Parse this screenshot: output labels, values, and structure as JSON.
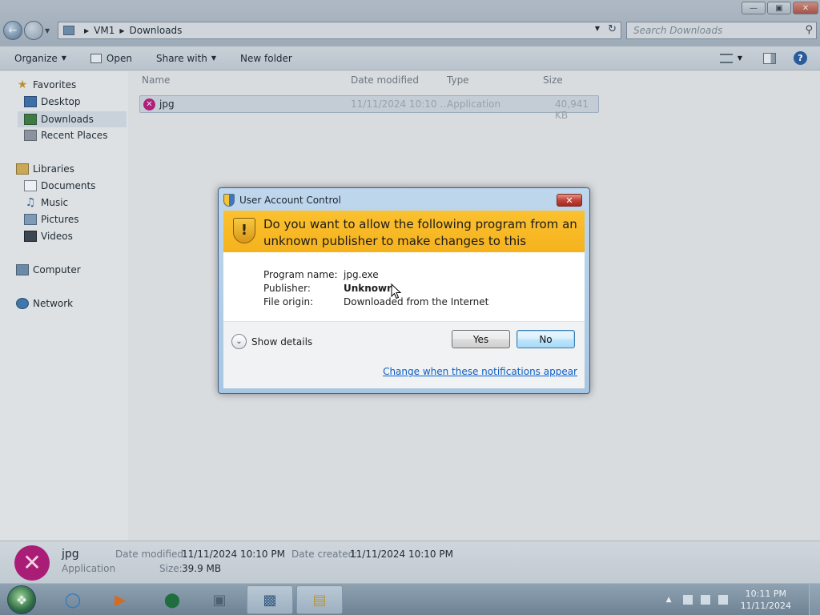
{
  "window": {
    "address": [
      "VM1",
      "Downloads"
    ],
    "search_placeholder": "Search Downloads",
    "buttons": {
      "minimize": "▭",
      "maximize": "▣",
      "close": "✕"
    }
  },
  "toolbar": {
    "organize": "Organize",
    "open": "Open",
    "share_with": "Share with",
    "new_folder": "New folder"
  },
  "sidebar": {
    "favorites": "Favorites",
    "desktop": "Desktop",
    "downloads": "Downloads",
    "recent_places": "Recent Places",
    "libraries": "Libraries",
    "documents": "Documents",
    "music": "Music",
    "pictures": "Pictures",
    "videos": "Videos",
    "computer": "Computer",
    "network": "Network"
  },
  "file_list": {
    "columns": [
      "Name",
      "Date modified",
      "Type",
      "Size"
    ],
    "rows": [
      {
        "name": "jpg",
        "date_modified": "11/11/2024 10:10 ...",
        "type": "Application",
        "size": "40,941 KB",
        "selected": true
      }
    ]
  },
  "details_pane": {
    "name": "jpg",
    "type": "Application",
    "date_modified_label": "Date modified:",
    "date_modified": "11/11/2024 10:10 PM",
    "date_created_label": "Date created:",
    "date_created": "11/11/2024 10:10 PM",
    "size_label": "Size:",
    "size": "39.9 MB"
  },
  "uac_dialog": {
    "title": "User Account Control",
    "question": "Do you want to allow the following program from an unknown publisher to make changes to this computer?",
    "program_name_label": "Program name:",
    "program_name": "jpg.exe",
    "publisher_label": "Publisher:",
    "publisher": "Unknown",
    "file_origin_label": "File origin:",
    "file_origin": "Downloaded from the Internet",
    "show_details": "Show details",
    "yes": "Yes",
    "no": "No",
    "link": "Change when these notifications appear",
    "colors": {
      "banner": "#f5b21d",
      "link": "#0b5ec5"
    }
  },
  "taskbar": {
    "apps": [
      "internet-explorer-icon",
      "media-player-icon",
      "chrome-icon",
      "control-panel-icon",
      "remote-desktop-icon",
      "explorer-folder-icon"
    ],
    "clock_time": "10:11 PM",
    "clock_date": "11/11/2024"
  }
}
